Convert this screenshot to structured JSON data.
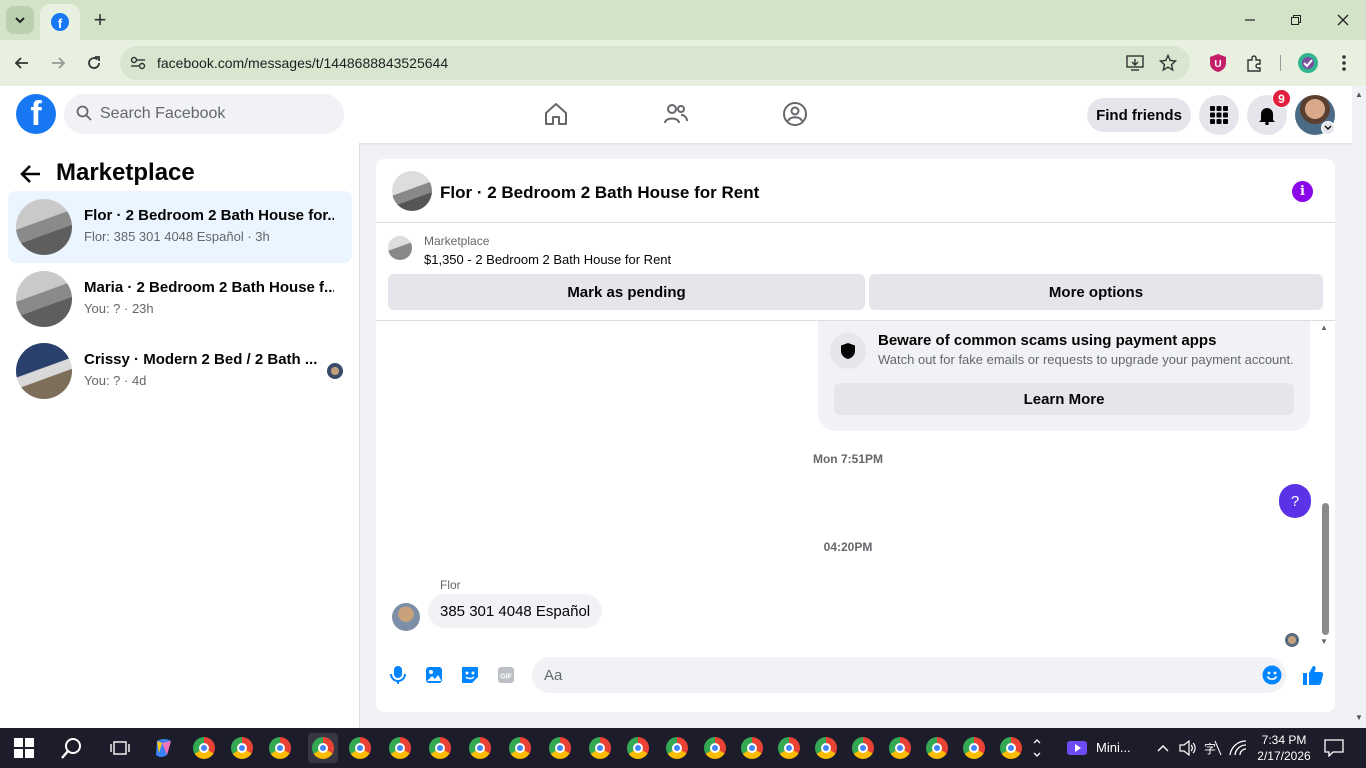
{
  "browser": {
    "url": "facebook.com/messages/t/1448688843525644",
    "new_tab_glyph": "+",
    "icons": [
      "tab-search-icon",
      "facebook-favicon",
      "back-icon",
      "forward-icon",
      "reload-icon",
      "site-info-icon",
      "install-icon",
      "bookmark-star-icon",
      "extension-icon",
      "profile-icon"
    ]
  },
  "fb": {
    "logo_letter": "f",
    "search_placeholder": "Search Facebook",
    "find_friends": "Find friends",
    "notifications_count": "9"
  },
  "sidebar": {
    "title": "Marketplace",
    "conversations": [
      {
        "title": "Flor · 2 Bedroom 2 Bath House for...",
        "sub": "Flor: 385 301 4048 Español · 3h"
      },
      {
        "title": "Maria · 2 Bedroom 2 Bath House f...",
        "sub": "You: ? · 23h"
      },
      {
        "title": "Crissy · Modern 2 Bed / 2 Bath ...",
        "sub": "You: ? · 4d"
      }
    ]
  },
  "chat": {
    "title": "Flor · 2 Bedroom 2 Bath House for Rent",
    "info_glyph": "i",
    "marketplace_label": "Marketplace",
    "listing": "$1,350 - 2 Bedroom 2 Bath House for Rent",
    "mark_pending": "Mark as pending",
    "more_options": "More options",
    "scam_title": "Beware of common scams using payment apps",
    "scam_sub": "Watch out for fake emails or requests to upgrade your payment account.",
    "learn_more": "Learn More",
    "timestamp1": "Mon 7:51PM",
    "outgoing_msg": "?",
    "timestamp2": "04:20PM",
    "sender": "Flor",
    "incoming_msg": "385 301 4048 Español",
    "composer_placeholder": "Aa"
  },
  "taskbar": {
    "app_label": "Mini...",
    "time": "7:34 PM",
    "date": "2/17/2026"
  },
  "colors": {
    "fb_blue": "#1877f2",
    "info_purple": "#8b06e8",
    "outgoing_bubble": "#5b32e6",
    "badge_red": "#e41e3f"
  }
}
